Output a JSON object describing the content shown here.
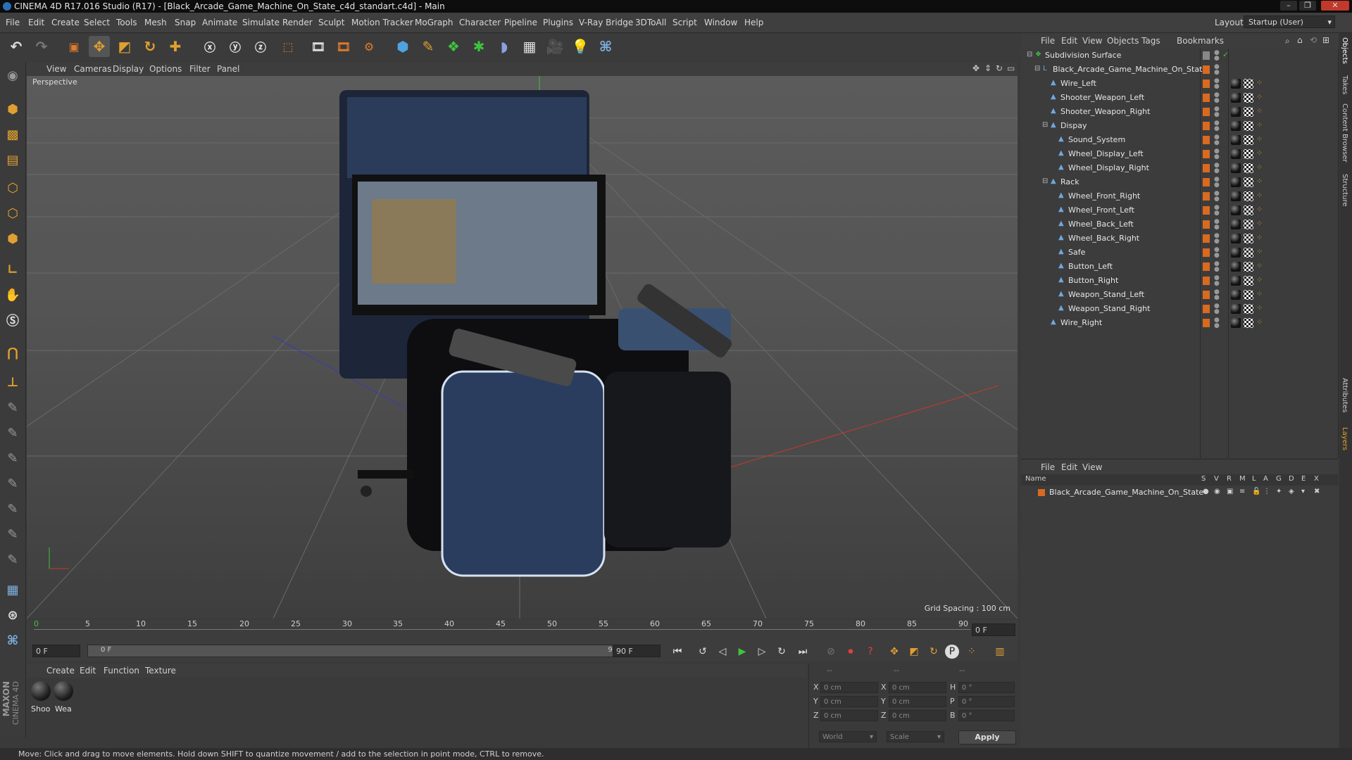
{
  "window": {
    "title": "CINEMA 4D R17.016 Studio (R17) - [Black_Arcade_Game_Machine_On_State_c4d_standart.c4d] - Main"
  },
  "menubar": [
    "File",
    "Edit",
    "Create",
    "Select",
    "Tools",
    "Mesh",
    "Snap",
    "Animate",
    "Simulate",
    "Render",
    "Sculpt",
    "Motion Tracker",
    "MoGraph",
    "Character",
    "Pipeline",
    "Plugins",
    "V-Ray Bridge",
    "3DToAll",
    "Script",
    "Window",
    "Help"
  ],
  "layout": {
    "label": "Layout:",
    "value": "Startup (User)"
  },
  "viewport": {
    "menu": [
      "View",
      "Cameras",
      "Display",
      "Options",
      "Filter",
      "Panel"
    ],
    "label": "Perspective",
    "grid_spacing": "Grid Spacing : 100 cm"
  },
  "timeline": {
    "ticks": [
      "0",
      "5",
      "10",
      "15",
      "20",
      "25",
      "30",
      "35",
      "40",
      "45",
      "50",
      "55",
      "60",
      "65",
      "70",
      "75",
      "80",
      "85",
      "90"
    ],
    "current_frame": "0 F",
    "start_field": "0 F",
    "range_start": "0 F",
    "range_end": "90 F",
    "end_field": "90 F"
  },
  "material_manager": {
    "menu": [
      "Create",
      "Edit",
      "Function",
      "Texture"
    ],
    "materials": [
      {
        "label": "Shoo"
      },
      {
        "label": "Wea"
      }
    ]
  },
  "coordinates": {
    "headers": [
      "--",
      "--",
      "--"
    ],
    "rows": [
      {
        "pos_label": "X",
        "pos": "0 cm",
        "size_label": "X",
        "size": "0 cm",
        "rot_label": "H",
        "rot": "0 °"
      },
      {
        "pos_label": "Y",
        "pos": "0 cm",
        "size_label": "Y",
        "size": "0 cm",
        "rot_label": "P",
        "rot": "0 °"
      },
      {
        "pos_label": "Z",
        "pos": "0 cm",
        "size_label": "Z",
        "size": "0 cm",
        "rot_label": "B",
        "rot": "0 °"
      }
    ],
    "mode": "World",
    "transform": "Scale",
    "apply": "Apply"
  },
  "object_manager": {
    "menu": [
      "File",
      "Edit",
      "View",
      "Objects",
      "Tags",
      "Bookmarks"
    ],
    "objects": [
      {
        "name": "Subdivision Surface",
        "depth": 0
      },
      {
        "name": "Black_Arcade_Game_Machine_On_State",
        "depth": 1
      },
      {
        "name": "Wire_Left",
        "depth": 2
      },
      {
        "name": "Shooter_Weapon_Left",
        "depth": 2
      },
      {
        "name": "Shooter_Weapon_Right",
        "depth": 2
      },
      {
        "name": "Dispay",
        "depth": 2
      },
      {
        "name": "Sound_System",
        "depth": 3
      },
      {
        "name": "Wheel_Display_Left",
        "depth": 3
      },
      {
        "name": "Wheel_Display_Right",
        "depth": 3
      },
      {
        "name": "Rack",
        "depth": 2
      },
      {
        "name": "Wheel_Front_Right",
        "depth": 3
      },
      {
        "name": "Wheel_Front_Left",
        "depth": 3
      },
      {
        "name": "Wheel_Back_Left",
        "depth": 3
      },
      {
        "name": "Wheel_Back_Right",
        "depth": 3
      },
      {
        "name": "Safe",
        "depth": 3
      },
      {
        "name": "Button_Left",
        "depth": 3
      },
      {
        "name": "Button_Right",
        "depth": 3
      },
      {
        "name": "Weapon_Stand_Left",
        "depth": 3
      },
      {
        "name": "Weapon_Stand_Right",
        "depth": 3
      },
      {
        "name": "Wire_Right",
        "depth": 2
      }
    ]
  },
  "layer_manager": {
    "menu": [
      "File",
      "Edit",
      "View"
    ],
    "columns": [
      "Name",
      "S",
      "V",
      "R",
      "M",
      "L",
      "A",
      "G",
      "D",
      "E",
      "X"
    ],
    "layers": [
      {
        "name": "Black_Arcade_Game_Machine_On_State"
      }
    ]
  },
  "right_tabs": [
    "Objects",
    "Takes",
    "Content Browser",
    "Structure",
    "Attributes",
    "Layers"
  ],
  "status": "Move: Click and drag to move elements. Hold down SHIFT to quantize movement / add to the selection in point mode, CTRL to remove.",
  "brand": {
    "vendor": "MAXON",
    "product": "CINEMA 4D"
  },
  "colors": {
    "accent": "#d96a1f",
    "object_icon": "#6fa8dc",
    "axis_y": "#3ec43e",
    "axis_x": "#c8382f",
    "axis_z": "#3a3ab8"
  }
}
